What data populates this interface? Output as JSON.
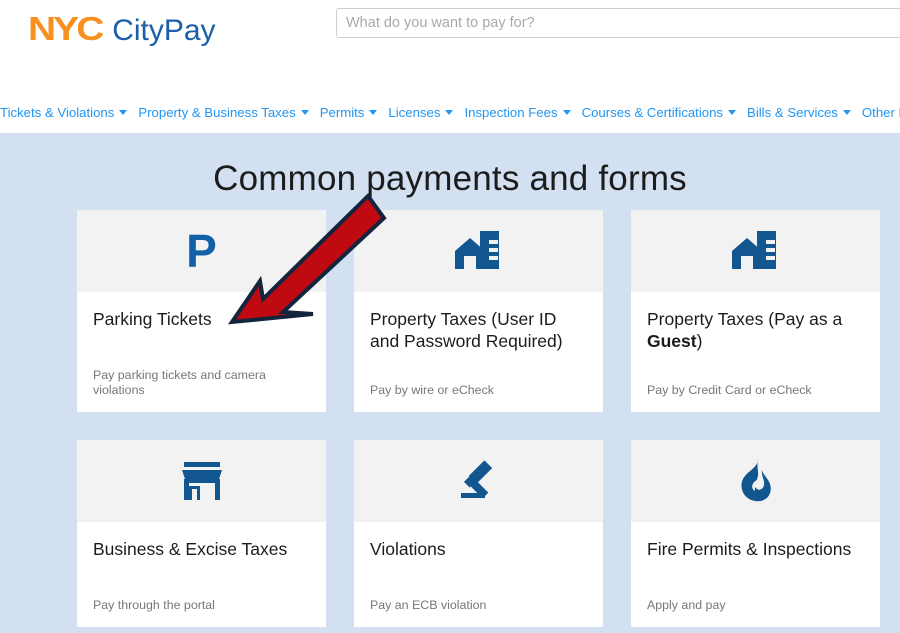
{
  "header": {
    "logo_nyc": "NYC",
    "logo_citypay": "CityPay",
    "search": {
      "placeholder": "What do you want to pay for?",
      "value": ""
    }
  },
  "nav": {
    "items": [
      {
        "label": "Tickets & Violations",
        "has_caret": true
      },
      {
        "label": "Property & Business Taxes",
        "has_caret": true
      },
      {
        "label": "Permits",
        "has_caret": true
      },
      {
        "label": "Licenses",
        "has_caret": true
      },
      {
        "label": "Inspection Fees",
        "has_caret": true
      },
      {
        "label": "Courses & Certifications",
        "has_caret": true
      },
      {
        "label": "Bills & Services",
        "has_caret": true
      },
      {
        "label": "Other Payments",
        "has_caret": true
      }
    ]
  },
  "main": {
    "title": "Common payments and forms",
    "cards": [
      {
        "icon": "parking-p-icon",
        "title": "Parking Tickets",
        "title_html": "Parking Tickets",
        "subtitle": "Pay parking tickets and camera violations"
      },
      {
        "icon": "property-building-icon",
        "title": "Property Taxes (User ID and Password Required)",
        "title_html": "Property Taxes (User ID and Password Required)",
        "subtitle": "Pay by wire or eCheck"
      },
      {
        "icon": "property-building-icon",
        "title": "Property Taxes (Pay as a Guest)",
        "title_html": "Property Taxes (Pay as a <b>Guest</b>)",
        "subtitle": "Pay by Credit Card or eCheck"
      },
      {
        "icon": "storefront-icon",
        "title": "Business & Excise Taxes",
        "title_html": "Business &amp; Excise Taxes",
        "subtitle": "Pay through the portal"
      },
      {
        "icon": "gavel-icon",
        "title": "Violations",
        "title_html": "Violations",
        "subtitle": "Pay an ECB violation"
      },
      {
        "icon": "flame-icon",
        "title": "Fire Permits & Inspections",
        "title_html": "Fire Permits &amp; Inspections",
        "subtitle": "Apply and pay"
      }
    ]
  },
  "annotation": {
    "type": "arrow",
    "color_fill": "#BE0A10",
    "color_stroke": "#12243E",
    "points_from": [
      367,
      199
    ],
    "points_to": [
      231,
      321
    ],
    "target": "Parking Tickets"
  },
  "colors": {
    "brand_orange": "#F7901E",
    "brand_blue": "#1B5FAA",
    "nav_blue": "#2196F3",
    "page_background": "#D3E0F2",
    "card_icon_bg": "#F2F2F2",
    "icon_blue": "#12568F"
  }
}
